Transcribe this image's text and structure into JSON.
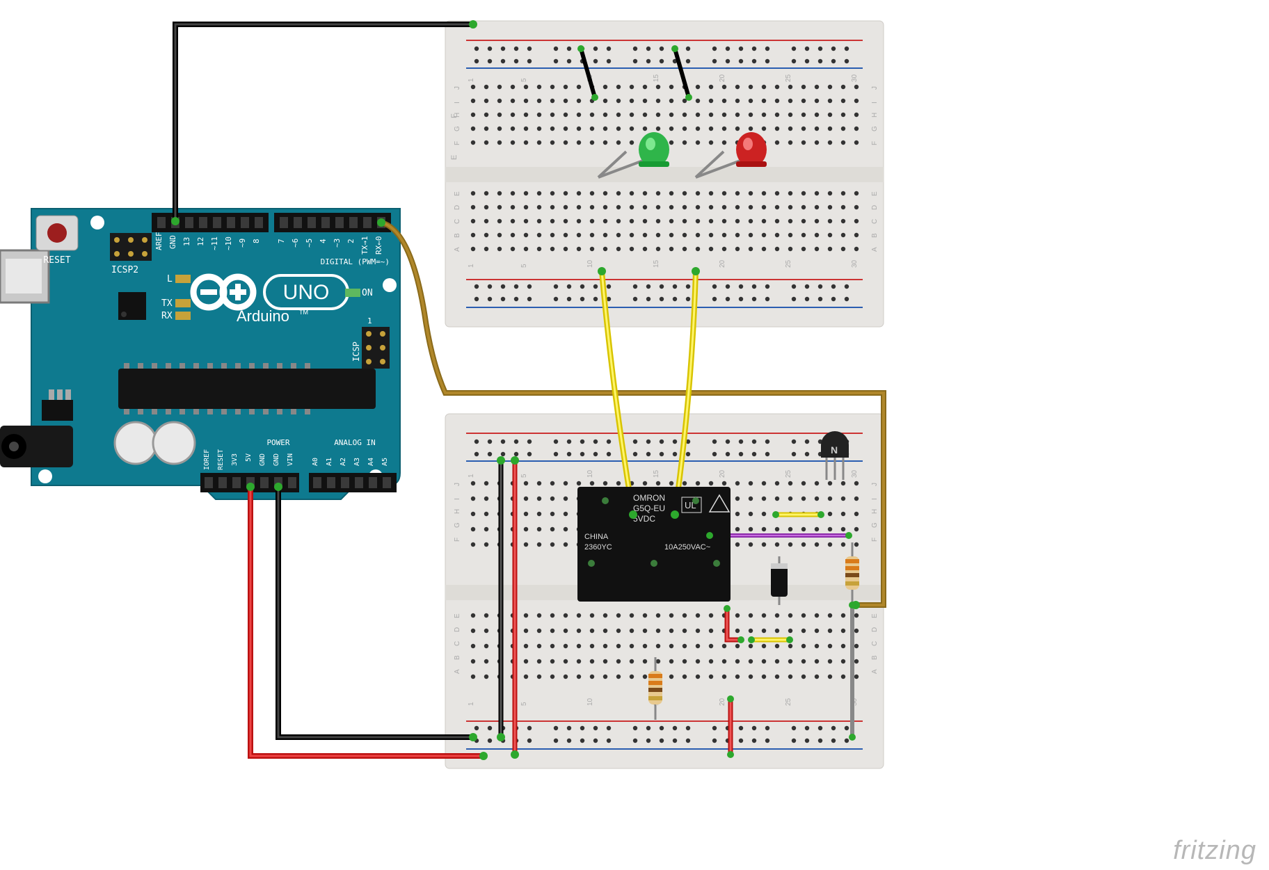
{
  "watermark": "fritzing",
  "arduino": {
    "reset_label": "RESET",
    "icsp2_label": "ICSP2",
    "icsp_label": "ICSP",
    "icsp_pin1_label": "1",
    "L_label": "L",
    "TX_label": "TX",
    "RX_label": "RX",
    "ON_label": "ON",
    "brand_line1": "Arduino",
    "brand_tm": "TM",
    "uno_label": "UNO",
    "digital_header_label": "DIGITAL (PWM=~)",
    "power_label": "POWER",
    "analog_label": "ANALOG IN",
    "digital_left_pins": [
      "AREF",
      "GND",
      "13",
      "12",
      "~11",
      "~10",
      "~9",
      "8"
    ],
    "digital_right_pins": [
      "7",
      "~6",
      "~5",
      "4",
      "~3",
      "2",
      "TX→1",
      "RX←0"
    ],
    "power_pins": [
      "IOREF",
      "RESET",
      "3V3",
      "5V",
      "GND",
      "GND",
      "VIN"
    ],
    "analog_pins": [
      "A0",
      "A1",
      "A2",
      "A3",
      "A4",
      "A5"
    ]
  },
  "relay": {
    "brand": "OMRON",
    "model": "G5Q-EU",
    "coil_voltage": "5VDC",
    "ul_mark": "UL",
    "origin": "CHINA",
    "date_code": "2360YC",
    "contact_rating": "10A250VAC~"
  },
  "components": {
    "led1": {
      "color": "green"
    },
    "led2": {
      "color": "red"
    },
    "diode": {
      "type": "rectifier"
    },
    "resistor1": {
      "type": "axial"
    },
    "resistor2": {
      "type": "axial"
    },
    "transistor": {
      "package": "TO92"
    }
  },
  "breadboards": {
    "top_row_labels_lower": [
      "A",
      "B",
      "C",
      "D",
      "E"
    ],
    "top_row_labels_upper": [
      "F",
      "G",
      "H",
      "I",
      "J"
    ],
    "column_numbers": [
      "1",
      "5",
      "10",
      "15",
      "20",
      "25",
      "30"
    ]
  },
  "wires": {
    "gnd_to_top_bb_rail": "black",
    "d0_to_bottom_bb": "olive",
    "5v_to_bottom_bb": "red",
    "gnd_bottom_bb": "black",
    "relay_out_to_leds": "yellow",
    "relay_jumpers": "yellow",
    "purple_jumper": "purple",
    "grey_jumper": "grey"
  }
}
